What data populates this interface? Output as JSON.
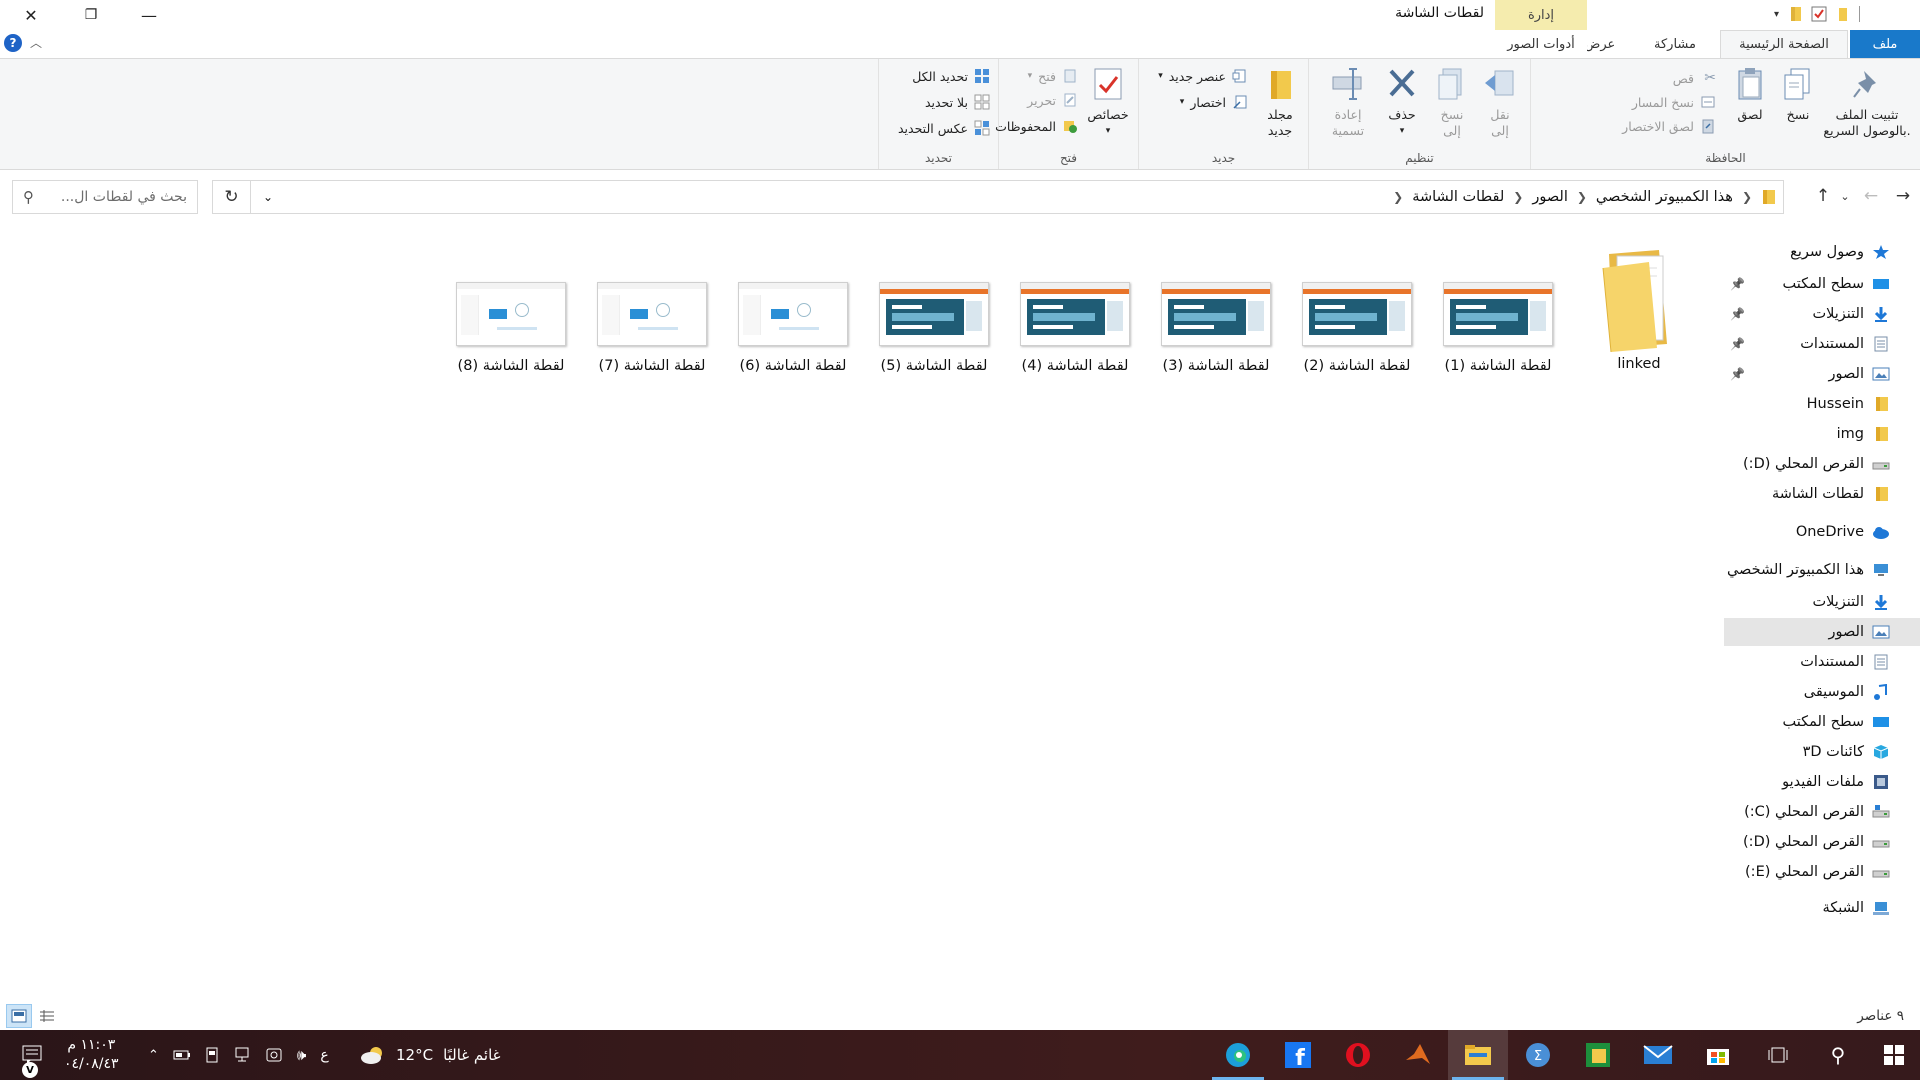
{
  "window": {
    "title": "لقطات الشاشة",
    "manage_label": "إدارة",
    "minimize": "—",
    "maximize": "❐",
    "close": "✕"
  },
  "ribbon_tabs": {
    "file": "ملف",
    "home": "الصفحة الرئيسية",
    "share": "مشاركة",
    "view": "عرض",
    "picture_tools": "أدوات الصور"
  },
  "help": "?",
  "ribbon": {
    "clipboard": {
      "label": "الحافظة",
      "pin_quick_access": "تثبيت الملف بالوصول السريع.",
      "copy": "نسخ",
      "paste": "لصق",
      "cut": "قص",
      "copy_path": "نسخ المسار",
      "paste_shortcut": "لصق الاختصار"
    },
    "organize": {
      "label": "تنظيم",
      "move_to": "نقل إلى",
      "copy_to": "نسخ إلى",
      "delete": "حذف",
      "rename": "إعادة تسمية"
    },
    "new": {
      "label": "جديد",
      "new_folder": "مجلد جديد",
      "new_item": "عنصر جديد",
      "easy_access": "اختصار"
    },
    "open": {
      "label": "فتح",
      "properties": "خصائص",
      "open": "فتح",
      "edit": "تحرير",
      "history": "المحفوظات"
    },
    "select": {
      "label": "تحديد",
      "select_all": "تحديد الكل",
      "select_none": "بلا تحديد",
      "invert": "عكس التحديد"
    }
  },
  "address": {
    "crumbs": [
      "هذا الكمبيوتر الشخصي",
      "الصور",
      "لقطات الشاشة"
    ],
    "search_placeholder": "بحث في لقطات ال..."
  },
  "nav": [
    {
      "label": "وصول سريع",
      "icon": "star-icon",
      "color": "#1e78d7",
      "pinned": false
    },
    {
      "label": "سطح المكتب",
      "icon": "desktop-icon",
      "color": "#1e90e6",
      "pinned": true
    },
    {
      "label": "التنزيلات",
      "icon": "download-icon",
      "color": "#1e78d7",
      "pinned": true
    },
    {
      "label": "المستندات",
      "icon": "documents-icon",
      "color": "#7a8fa8",
      "pinned": true
    },
    {
      "label": "الصور",
      "icon": "pictures-icon",
      "color": "#4a7fb8",
      "pinned": true
    },
    {
      "label": "Hussein",
      "icon": "folder-icon",
      "color": "#f2c94c",
      "pinned": false
    },
    {
      "label": "img",
      "icon": "folder-icon",
      "color": "#f2c94c",
      "pinned": false
    },
    {
      "label": "القرص المحلي (D:)",
      "icon": "drive-icon",
      "color": "#8a8a8a",
      "pinned": false
    },
    {
      "label": "لقطات الشاشة",
      "icon": "folder-icon",
      "color": "#f2c94c",
      "pinned": false
    },
    {
      "label": "OneDrive",
      "icon": "cloud-icon",
      "color": "#1e78d7",
      "pinned": false
    },
    {
      "label": "هذا الكمبيوتر الشخصي",
      "icon": "computer-icon",
      "color": "#3a8fd6",
      "pinned": false
    },
    {
      "label": "التنزيلات",
      "icon": "download-icon",
      "color": "#1e78d7",
      "pinned": false
    },
    {
      "label": "الصور",
      "icon": "pictures-icon",
      "color": "#4a7fb8",
      "pinned": false,
      "selected": true
    },
    {
      "label": "المستندات",
      "icon": "documents-icon",
      "color": "#7a8fa8",
      "pinned": false
    },
    {
      "label": "الموسيقى",
      "icon": "music-icon",
      "color": "#1e78d7",
      "pinned": false
    },
    {
      "label": "سطح المكتب",
      "icon": "desktop-icon",
      "color": "#1e90e6",
      "pinned": false
    },
    {
      "label": "كائنات ٣D",
      "icon": "cube-icon",
      "color": "#28a8e0",
      "pinned": false
    },
    {
      "label": "ملفات الفيديو",
      "icon": "video-icon",
      "color": "#3b5a8a",
      "pinned": false
    },
    {
      "label": "القرص المحلي (C:)",
      "icon": "windows-drive-icon",
      "color": "#8a8a8a",
      "pinned": false
    },
    {
      "label": "القرص المحلي (D:)",
      "icon": "drive-icon",
      "color": "#8a8a8a",
      "pinned": false
    },
    {
      "label": "القرص المحلي (E:)",
      "icon": "drive-icon",
      "color": "#8a8a8a",
      "pinned": false
    },
    {
      "label": "الشبكة",
      "icon": "network-icon",
      "color": "#3a8fd6",
      "pinned": false
    }
  ],
  "files": [
    {
      "name": "linked",
      "kind": "folder"
    },
    {
      "name": "لقطة الشاشة (1)",
      "kind": "screenshot-dark"
    },
    {
      "name": "لقطة الشاشة (2)",
      "kind": "screenshot-dark"
    },
    {
      "name": "لقطة الشاشة (3)",
      "kind": "screenshot-dark"
    },
    {
      "name": "لقطة الشاشة (4)",
      "kind": "screenshot-dark"
    },
    {
      "name": "لقطة الشاشة (5)",
      "kind": "screenshot-dark"
    },
    {
      "name": "لقطة الشاشة (6)",
      "kind": "screenshot-light"
    },
    {
      "name": "لقطة الشاشة (7)",
      "kind": "screenshot-light"
    },
    {
      "name": "لقطة الشاشة (8)",
      "kind": "screenshot-light"
    }
  ],
  "status": {
    "item_count": "٩ عناصر"
  },
  "taskbar": {
    "weather_temp": "12°C",
    "weather_text": "غائم غالبًا",
    "time": "١١:٠٣ م",
    "date": "٠٤/٠٨/٤٣",
    "lang": "ع",
    "apps": [
      "start-icon",
      "search-icon",
      "task-view-icon",
      "store-icon",
      "mail-icon",
      "app-icon",
      "app-icon",
      "file-explorer-icon",
      "matlab-icon",
      "opera-icon",
      "facebook-icon",
      "edge-icon"
    ]
  },
  "colors": {
    "accent": "#1979ca",
    "manage_tab": "#f5ecae",
    "selection": "#e5e5e5",
    "taskbar": "#3b1b1b"
  }
}
